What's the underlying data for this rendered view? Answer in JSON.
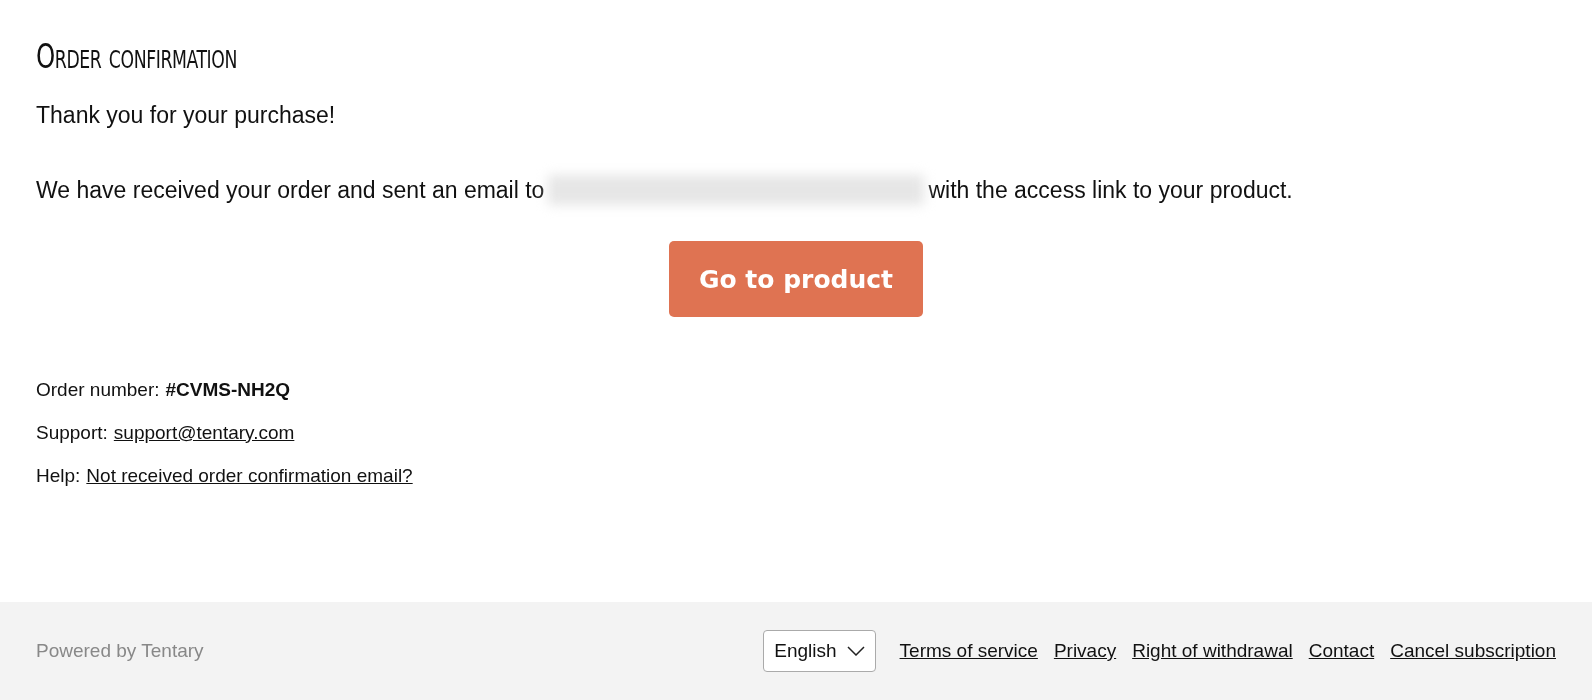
{
  "title": "Order confirmation",
  "thanks": "Thank you for your purchase!",
  "message": {
    "before": "We have received your order and sent an email to",
    "after": "with the access link to your product."
  },
  "button": "Go to product",
  "details": [
    {
      "label": "Order number:",
      "value": "#CVMS-NH2Q",
      "kind": "bold"
    },
    {
      "label": "Support:",
      "value": "support@tentary.com",
      "kind": "link"
    },
    {
      "label": "Help:",
      "value": "Not received order confirmation email?",
      "kind": "link"
    }
  ],
  "footer": {
    "powered_by": "Powered by Tentary",
    "language": "English",
    "links": [
      "Terms of service",
      "Privacy",
      "Right of withdrawal",
      "Contact",
      "Cancel subscription"
    ]
  }
}
